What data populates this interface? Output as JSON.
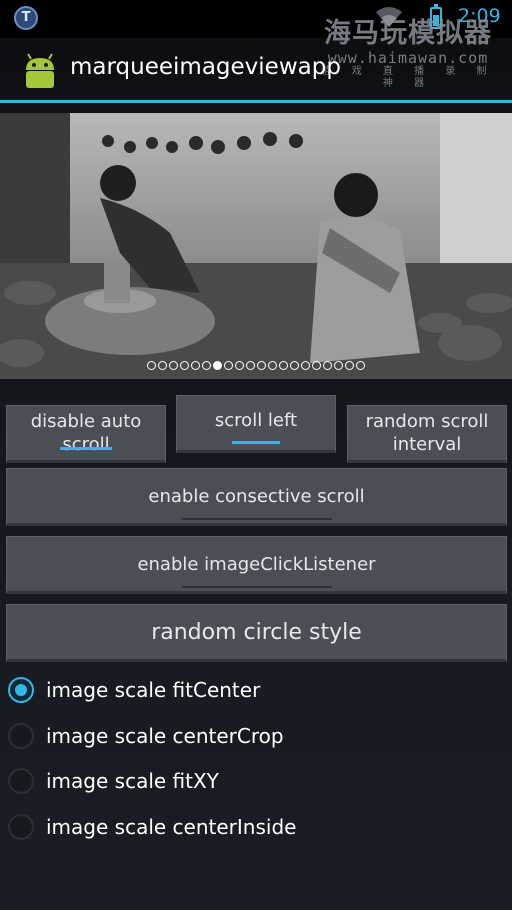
{
  "status_bar": {
    "time": "2:09",
    "app_notification_icon": "shield-t-icon",
    "wifi_icon": "wifi-icon",
    "battery_icon": "battery-charging-icon",
    "watermark_title": "海马玩模拟器",
    "watermark_url": "www.haimawan.com",
    "watermark_sub": "游 戏 直 播 录 制 神 器"
  },
  "action_bar": {
    "icon": "android-robot-icon",
    "title": "marqueeimageviewapp"
  },
  "marquee": {
    "image_description_icon": "potters-photo-image",
    "page_count": 20,
    "active_index": 6
  },
  "buttons": {
    "disable_auto_scroll": "disable auto scroll",
    "scroll_left": "scroll left",
    "random_scroll_interval": "random scroll interval",
    "enable_consective_scroll": "enable consective scroll",
    "enable_image_click_listener": "enable imageClickListener",
    "random_circle_style": "random circle style"
  },
  "scale_options": [
    {
      "label": "image scale fitCenter",
      "checked": true
    },
    {
      "label": "image scale centerCrop",
      "checked": false
    },
    {
      "label": "image scale fitXY",
      "checked": false
    },
    {
      "label": "image scale centerInside",
      "checked": false
    }
  ],
  "colors": {
    "accent": "#33b5e5",
    "button_bg": "#4a4e55",
    "background": "#15171b"
  }
}
